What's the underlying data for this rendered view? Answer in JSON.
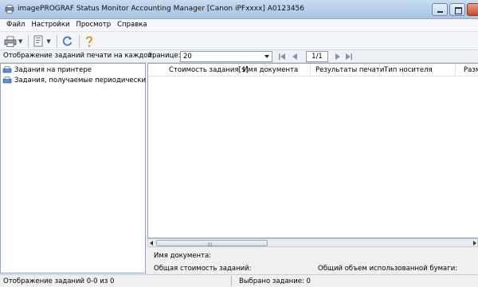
{
  "window": {
    "title": "imagePROGRAF Status Monitor Accounting Manager [Canon iPFxxxx]  A0123456",
    "icon": "printer-app-icon",
    "accent": "#b7cfe9"
  },
  "menu": [
    "Файл",
    "Настройки",
    "Просмотр",
    "Справка"
  ],
  "toolbar": {
    "icons": [
      "printer-icon",
      "properties-icon",
      "refresh-icon",
      "help-icon"
    ]
  },
  "nav": {
    "left_label": "Отображение заданий печати на каждой",
    "right_label": "транице:",
    "per_page_value": "20",
    "page_indicator": "1/1"
  },
  "tree": [
    {
      "label": "Задания на принтере",
      "icon": "printer-jobs-icon"
    },
    {
      "label": "Задания, получаемые периодически",
      "icon": "periodic-jobs-icon"
    }
  ],
  "columns": [
    "Стоимость задания[$]",
    "Имя документа",
    "Результаты печати",
    "Тип носителя",
    "Разм"
  ],
  "details": {
    "doc_name_label": "Имя документа:",
    "total_cost_label": "Общая стоимость заданий:",
    "total_paper_label": "Общий объем использованной бумаги:"
  },
  "status": {
    "left": "Отображение заданий 0-0 из 0",
    "middle": "Выбрано задание: 0"
  }
}
